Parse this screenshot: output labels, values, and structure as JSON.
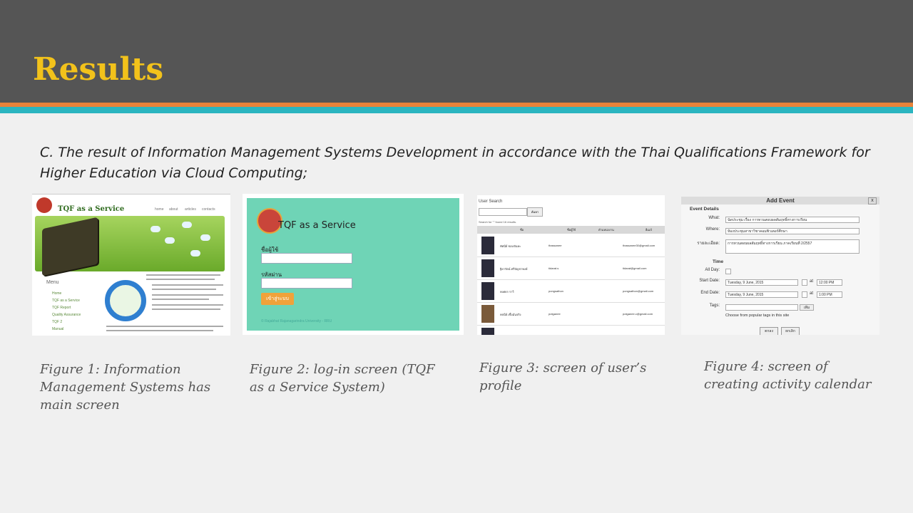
{
  "slide": {
    "title": "Results",
    "body_lead": "C.",
    "body_text": " The result of Information Management Systems Development in accordance with the Thai Qualifications Framework for Higher Education via Cloud Computing;",
    "colors": {
      "header": "#555555",
      "title": "#f2c21b",
      "stripe_orange": "#e8833a",
      "stripe_teal": "#2bb5c0"
    }
  },
  "figure1": {
    "brand": "TQF as a Service",
    "nav": [
      "home",
      "about",
      "articles",
      "contacts"
    ],
    "menu_title": "Menu",
    "menu_items": [
      "Home",
      "TQF as a Service",
      "TQF Report",
      "Quality Assurance",
      "TQF 2",
      "Manual"
    ],
    "caption": "Figure 1: Information Management Systems has main screen"
  },
  "figure2": {
    "brand": "TQF as a Service",
    "username_label": "ชื่อผู้ใช้",
    "password_label": "รหัสผ่าน",
    "login_button": "เข้าสู่ระบบ",
    "footer": "© Rajabhat Rajanagarindra University - RRU",
    "caption": "Figure 2: log-in screen (TQF as a Service System)"
  },
  "figure3": {
    "title": "User Search",
    "search_button": "ค้นหา",
    "result_note": "Search for \"\" found 16 results.",
    "columns": [
      "ชื่อ",
      "ชื่อผู้ใช้",
      "ตำแหน่งงาน",
      "อีเมล์"
    ],
    "rows": [
      {
        "name": "ทัศนีย์ ชอบขันทะ",
        "user": "thassanee",
        "email": "thassanee30@gmail.com"
      },
      {
        "name": "ฐิดารัตน์ ศรีบัญชาพงษ์",
        "user": "tidarat.s",
        "email": "tidarat@gmail.com"
      },
      {
        "name": "พงศธร ราวี",
        "user": "pongsathon",
        "email": "pongsathon@gmail.com"
      },
      {
        "name": "พจนีย์ เชื้อมั่นจริง",
        "user": "potganee",
        "email": "potganee.c@gmail.com"
      },
      {
        "name": "",
        "user": "",
        "email": ""
      }
    ],
    "caption": "Figure 3: screen of user’s profile"
  },
  "figure4": {
    "dialog_title": "Add Event",
    "close": "x",
    "section_details": "Event Details",
    "what_label": "What:",
    "what_value": "นัดประชุม เรื่อง การทวนสอบผลสัมฤทธิ์ทางการเรียน",
    "where_label": "Where:",
    "where_value": "ห้องประชุมสาขาวิชาคอมพิวเตอร์ศึกษา",
    "details_label": "รายละเอียด:",
    "details_value": "การทวนสอบผลสัมฤทธิ์ทางการเรียน ภาคเรียนที่ 2/2557",
    "section_time": "Time",
    "allday_label": "All Day:",
    "start_label": "Start Date:",
    "start_date": "Tuesday, 9 June, 2015",
    "start_time": "12:00 PM",
    "end_label": "End Date:",
    "end_date": "Tuesday, 9 June, 2015",
    "end_time": "1:00 PM",
    "at": "at",
    "tags_label": "Tags:",
    "tags_button": "เพิ่ม",
    "tags_hint": "Choose from popular tags in this site",
    "ok_button": "ตกลง",
    "cancel_button": "ยกเลิก",
    "caption": "Figure 4: screen of creating activity calendar"
  }
}
